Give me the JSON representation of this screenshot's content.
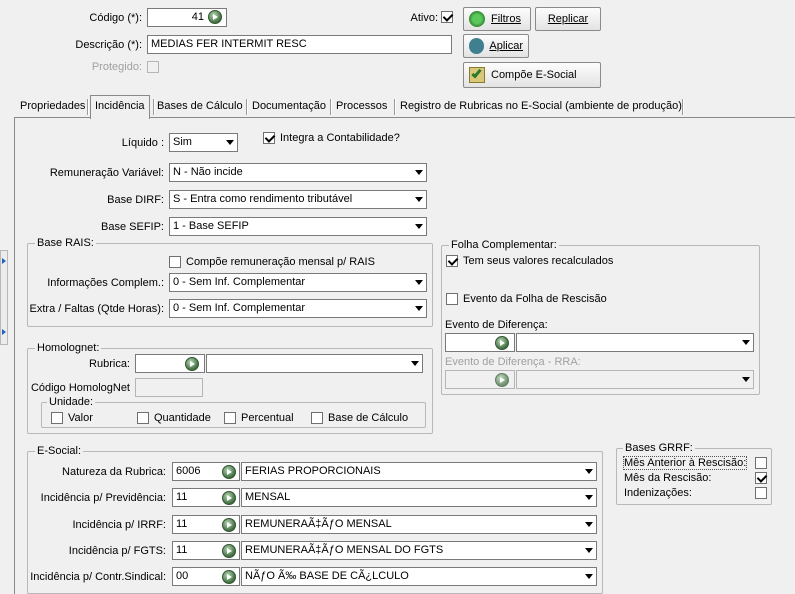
{
  "header": {
    "codigo_label": "Código (*):",
    "codigo_value": "41",
    "ativo_label": "Ativo:",
    "ativo_checked": true,
    "descricao_label": "Descrição (*):",
    "descricao_value": "MEDIAS FER INTERMIT RESC",
    "protegido_label": "Protegido:",
    "filtros_button": "Filtros",
    "replicar_button": "Replicar",
    "aplicar_button": "Aplicar",
    "compoe_esocial_button": "Compõe E-Social"
  },
  "tabs": [
    {
      "label": "Propriedades",
      "active": false
    },
    {
      "label": "Incidência",
      "active": true
    },
    {
      "label": "Bases de Cálculo",
      "active": false
    },
    {
      "label": "Documentação",
      "active": false
    },
    {
      "label": "Processos",
      "active": false
    },
    {
      "label": "Registro de Rubricas no E-Social (ambiente de produção)",
      "active": false
    }
  ],
  "incidencia": {
    "liquido_label": "Líquido :",
    "liquido_value": "Sim",
    "integra_contabilidade_label": "Integra a Contabilidade?",
    "integra_contabilidade_checked": true,
    "remuneracao_variavel_label": "Remuneração Variável:",
    "remuneracao_variavel_value": "N - Não incide",
    "base_dirf_label": "Base DIRF:",
    "base_dirf_value": "S - Entra como rendimento tributável",
    "base_sefip_label": "Base SEFIP:",
    "base_sefip_value": "1 - Base SEFIP"
  },
  "base_rais": {
    "title": "Base RAIS:",
    "compoe_remuneracao_label": "Compõe remuneração mensal p/ RAIS",
    "info_complem_label": "Informações Complem.:",
    "info_complem_value": "0 - Sem Inf. Complementar",
    "extra_faltas_label": "Extra / Faltas (Qtde Horas):",
    "extra_faltas_value": "0 - Sem Inf. Complementar"
  },
  "folha_complementar": {
    "title": "Folha Complementar:",
    "recalculados_label": "Tem seus valores recalculados",
    "recalculados_checked": true,
    "evento_rescisao_label": "Evento da Folha de Rescisão",
    "evento_diferenca_label": "Evento de Diferença:",
    "evento_diferenca_rra_label": "Evento de Diferença - RRA:"
  },
  "homolognet": {
    "title": "Homolognet:",
    "rubrica_label": "Rubrica:",
    "codigo_label": "Código HomologNet",
    "unidade_title": "Unidade:",
    "valor_label": "Valor",
    "quantidade_label": "Quantidade",
    "percentual_label": "Percentual",
    "base_calculo_label": "Base de Cálculo"
  },
  "esocial": {
    "title": "E-Social:",
    "rows": [
      {
        "label": "Natureza da Rubrica:",
        "code": "6006",
        "desc": "FERIAS PROPORCIONAIS"
      },
      {
        "label": "Incidência p/ Previdência:",
        "code": "11",
        "desc": "MENSAL"
      },
      {
        "label": "Incidência p/ IRRF:",
        "code": "11",
        "desc": "REMUNERAÃ‡ÃƒO MENSAL"
      },
      {
        "label": "Incidência p/ FGTS:",
        "code": "11",
        "desc": "REMUNERAÃ‡ÃƒO MENSAL DO FGTS"
      },
      {
        "label": "Incidência p/ Contr.Sindical:",
        "code": "00",
        "desc": "NÃƒO Ã‰ BASE DE CÃ¿LCULO"
      }
    ]
  },
  "bases_grrf": {
    "title": "Bases GRRF:",
    "mes_anterior_label": "Mês Anterior à Rescisão:",
    "mes_anterior_checked": false,
    "mes_rescisao_label": "Mês da Rescisão:",
    "mes_rescisao_checked": true,
    "indenizacoes_label": "Indenizações:",
    "indenizacoes_checked": false
  }
}
